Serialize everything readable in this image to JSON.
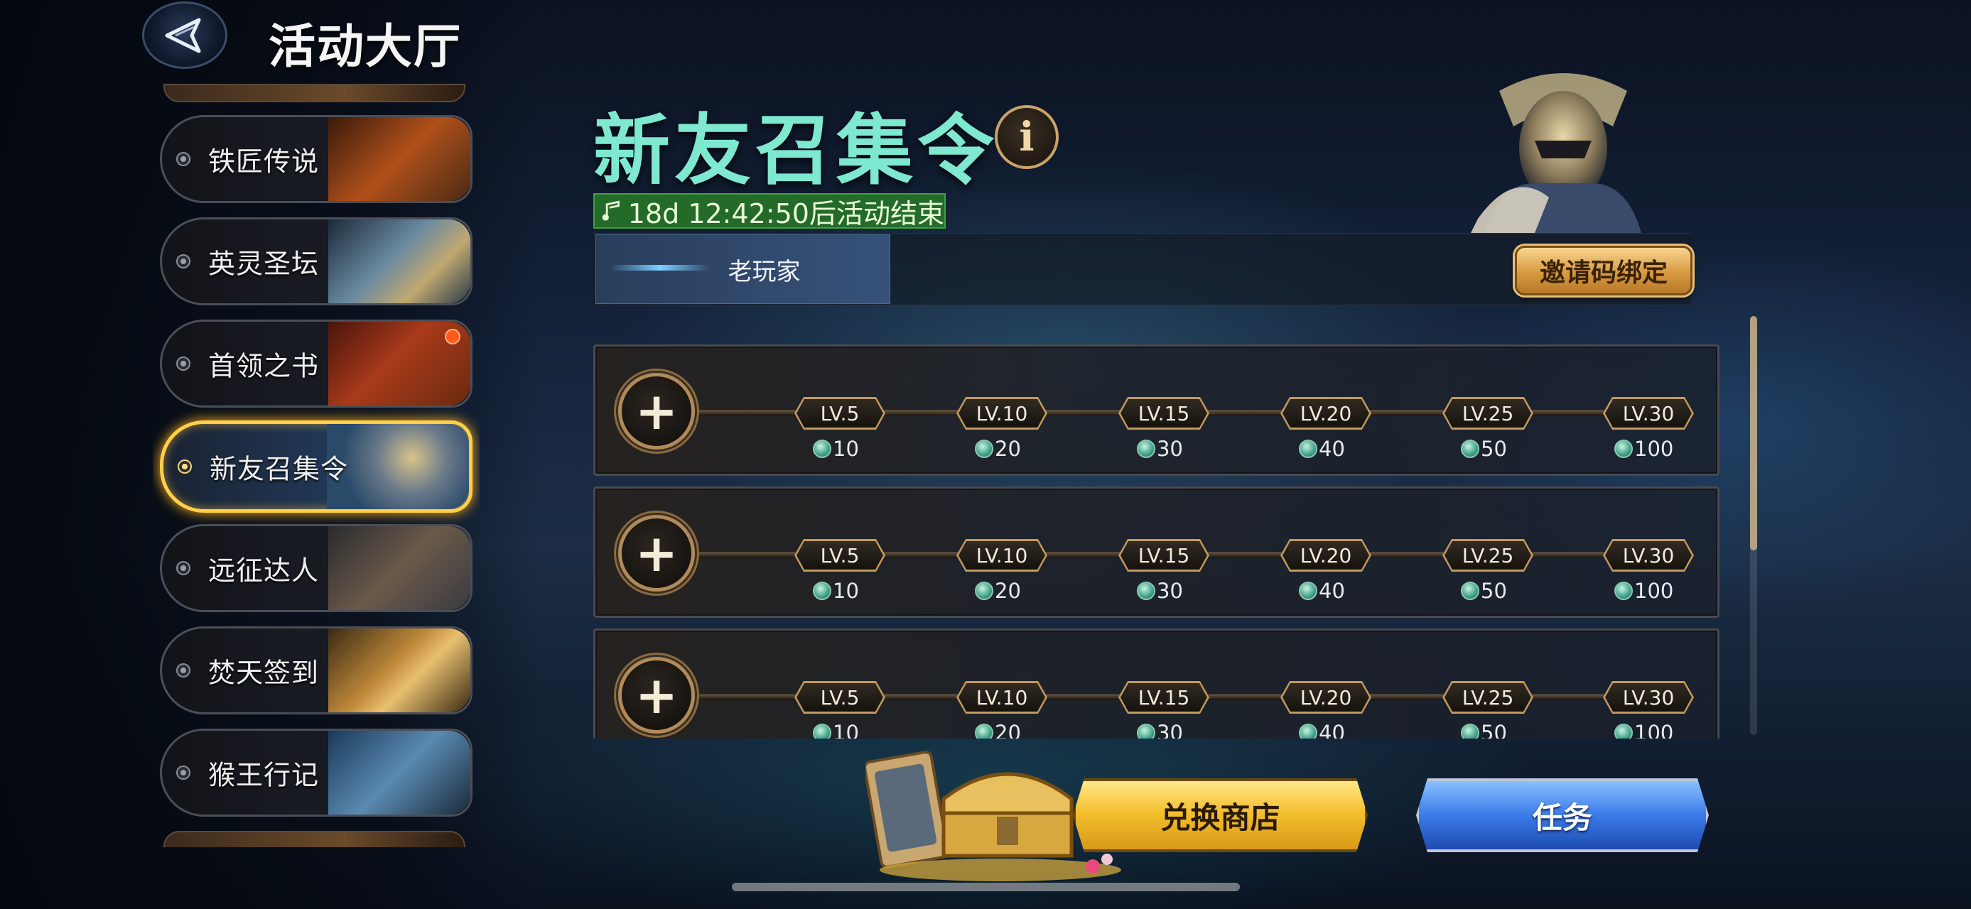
{
  "header": {
    "title": "活动大厅"
  },
  "sidebar": {
    "items": [
      {
        "label": "铁匠传说",
        "active": false,
        "badge": false
      },
      {
        "label": "英灵圣坛",
        "active": false,
        "badge": false
      },
      {
        "label": "首领之书",
        "active": false,
        "badge": true
      },
      {
        "label": "新友召集令",
        "active": true,
        "badge": false
      },
      {
        "label": "远征达人",
        "active": false,
        "badge": false
      },
      {
        "label": "焚天签到",
        "active": false,
        "badge": false
      },
      {
        "label": "猴王行记",
        "active": false,
        "badge": false
      }
    ]
  },
  "event": {
    "title": "新友召集令",
    "info_icon": "i",
    "timer": "18d 12:42:50后活动结束",
    "tab": "老玩家",
    "invite_button": "邀请码绑定"
  },
  "rewards": {
    "levels": [
      "LV.5",
      "LV.10",
      "LV.15",
      "LV.20",
      "LV.25",
      "LV.30"
    ],
    "amounts": [
      "10",
      "20",
      "30",
      "40",
      "50",
      "100"
    ],
    "rows": [
      {
        "slot": "+"
      },
      {
        "slot": "+"
      },
      {
        "slot": "+"
      }
    ]
  },
  "bottom": {
    "shop_button": "兑换商店",
    "task_button": "任务"
  },
  "colors": {
    "title_accent": "#7ee8d0",
    "active_border": "#ffcf4a",
    "timer_bg": "#2a7a2a",
    "shop_button": "#f4c030",
    "task_button": "#3a7ae8",
    "badge": "#ff5a1a"
  }
}
